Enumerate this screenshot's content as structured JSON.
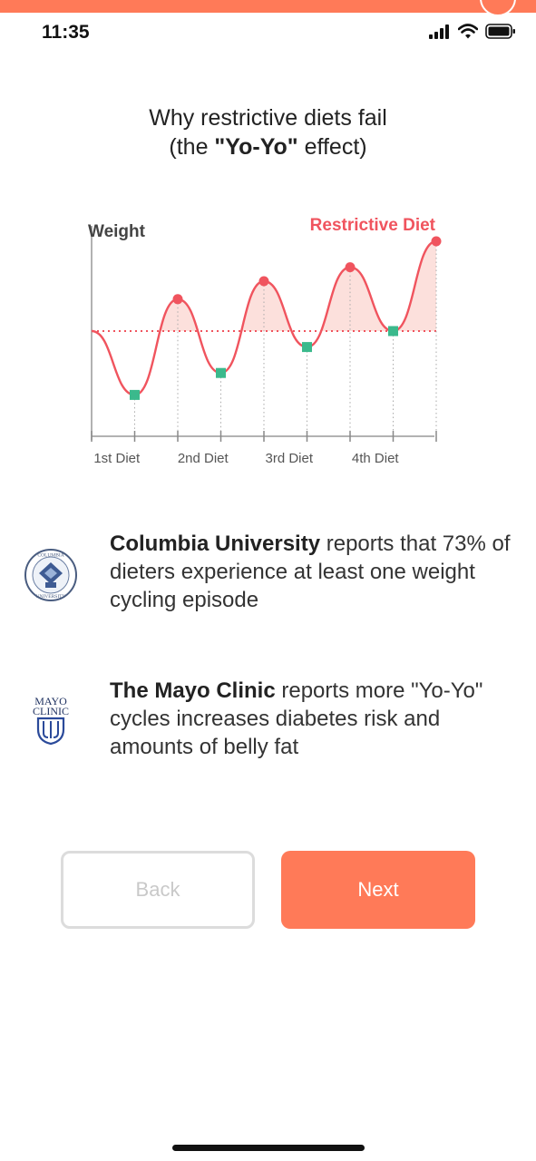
{
  "status_bar": {
    "time": "11:35",
    "icons": [
      "signal-icon",
      "wifi-icon",
      "battery-icon"
    ]
  },
  "headline": {
    "line1": "Why restrictive diets fail",
    "line2_prefix": "(the ",
    "line2_bold": "\"Yo-Yo\"",
    "line2_suffix": " effect)"
  },
  "chart_data": {
    "type": "line",
    "ylabel": "Weight",
    "series": [
      {
        "name": "Restrictive Diet",
        "values": [
          50,
          18,
          66,
          29,
          75,
          42,
          82,
          50,
          95
        ]
      }
    ],
    "x": [
      0,
      1,
      2,
      3,
      4,
      5,
      6,
      7,
      8
    ],
    "baseline": 50,
    "ylim": [
      0,
      100
    ],
    "categories": [
      "1st Diet",
      "2nd Diet",
      "3rd Diet",
      "4th Diet"
    ],
    "grid": false,
    "legend": "top-right",
    "colors": {
      "line": "#f0545e",
      "fill": "#fbdad6",
      "marker_low": "#3bb98c",
      "axis": "#888888"
    }
  },
  "citations": [
    {
      "logo": "columbia-university-seal",
      "bold": "Columbia University",
      "text": " reports that 73% of dieters experience at least one weight cycling episode"
    },
    {
      "logo": "mayo-clinic-logo",
      "bold": "The Mayo Clinic",
      "text": " reports more \"Yo-Yo\" cycles increases diabetes risk and amounts of belly fat"
    }
  ],
  "buttons": {
    "back": "Back",
    "next": "Next"
  },
  "colors": {
    "accent": "#ff7a58",
    "back_border": "#dcdcdc"
  }
}
